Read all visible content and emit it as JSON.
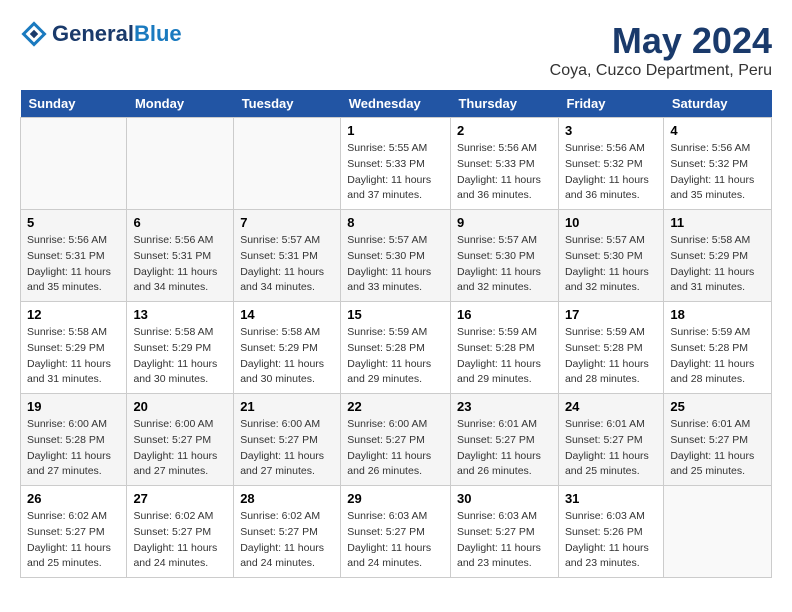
{
  "header": {
    "logo_line1": "General",
    "logo_line2": "Blue",
    "month_year": "May 2024",
    "location": "Coya, Cuzco Department, Peru"
  },
  "days_of_week": [
    "Sunday",
    "Monday",
    "Tuesday",
    "Wednesday",
    "Thursday",
    "Friday",
    "Saturday"
  ],
  "weeks": [
    [
      {
        "day": "",
        "sunrise": "",
        "sunset": "",
        "daylight": ""
      },
      {
        "day": "",
        "sunrise": "",
        "sunset": "",
        "daylight": ""
      },
      {
        "day": "",
        "sunrise": "",
        "sunset": "",
        "daylight": ""
      },
      {
        "day": "1",
        "sunrise": "5:55 AM",
        "sunset": "5:33 PM",
        "daylight": "11 hours and 37 minutes."
      },
      {
        "day": "2",
        "sunrise": "5:56 AM",
        "sunset": "5:33 PM",
        "daylight": "11 hours and 36 minutes."
      },
      {
        "day": "3",
        "sunrise": "5:56 AM",
        "sunset": "5:32 PM",
        "daylight": "11 hours and 36 minutes."
      },
      {
        "day": "4",
        "sunrise": "5:56 AM",
        "sunset": "5:32 PM",
        "daylight": "11 hours and 35 minutes."
      }
    ],
    [
      {
        "day": "5",
        "sunrise": "5:56 AM",
        "sunset": "5:31 PM",
        "daylight": "11 hours and 35 minutes."
      },
      {
        "day": "6",
        "sunrise": "5:56 AM",
        "sunset": "5:31 PM",
        "daylight": "11 hours and 34 minutes."
      },
      {
        "day": "7",
        "sunrise": "5:57 AM",
        "sunset": "5:31 PM",
        "daylight": "11 hours and 34 minutes."
      },
      {
        "day": "8",
        "sunrise": "5:57 AM",
        "sunset": "5:30 PM",
        "daylight": "11 hours and 33 minutes."
      },
      {
        "day": "9",
        "sunrise": "5:57 AM",
        "sunset": "5:30 PM",
        "daylight": "11 hours and 32 minutes."
      },
      {
        "day": "10",
        "sunrise": "5:57 AM",
        "sunset": "5:30 PM",
        "daylight": "11 hours and 32 minutes."
      },
      {
        "day": "11",
        "sunrise": "5:58 AM",
        "sunset": "5:29 PM",
        "daylight": "11 hours and 31 minutes."
      }
    ],
    [
      {
        "day": "12",
        "sunrise": "5:58 AM",
        "sunset": "5:29 PM",
        "daylight": "11 hours and 31 minutes."
      },
      {
        "day": "13",
        "sunrise": "5:58 AM",
        "sunset": "5:29 PM",
        "daylight": "11 hours and 30 minutes."
      },
      {
        "day": "14",
        "sunrise": "5:58 AM",
        "sunset": "5:29 PM",
        "daylight": "11 hours and 30 minutes."
      },
      {
        "day": "15",
        "sunrise": "5:59 AM",
        "sunset": "5:28 PM",
        "daylight": "11 hours and 29 minutes."
      },
      {
        "day": "16",
        "sunrise": "5:59 AM",
        "sunset": "5:28 PM",
        "daylight": "11 hours and 29 minutes."
      },
      {
        "day": "17",
        "sunrise": "5:59 AM",
        "sunset": "5:28 PM",
        "daylight": "11 hours and 28 minutes."
      },
      {
        "day": "18",
        "sunrise": "5:59 AM",
        "sunset": "5:28 PM",
        "daylight": "11 hours and 28 minutes."
      }
    ],
    [
      {
        "day": "19",
        "sunrise": "6:00 AM",
        "sunset": "5:28 PM",
        "daylight": "11 hours and 27 minutes."
      },
      {
        "day": "20",
        "sunrise": "6:00 AM",
        "sunset": "5:27 PM",
        "daylight": "11 hours and 27 minutes."
      },
      {
        "day": "21",
        "sunrise": "6:00 AM",
        "sunset": "5:27 PM",
        "daylight": "11 hours and 27 minutes."
      },
      {
        "day": "22",
        "sunrise": "6:00 AM",
        "sunset": "5:27 PM",
        "daylight": "11 hours and 26 minutes."
      },
      {
        "day": "23",
        "sunrise": "6:01 AM",
        "sunset": "5:27 PM",
        "daylight": "11 hours and 26 minutes."
      },
      {
        "day": "24",
        "sunrise": "6:01 AM",
        "sunset": "5:27 PM",
        "daylight": "11 hours and 25 minutes."
      },
      {
        "day": "25",
        "sunrise": "6:01 AM",
        "sunset": "5:27 PM",
        "daylight": "11 hours and 25 minutes."
      }
    ],
    [
      {
        "day": "26",
        "sunrise": "6:02 AM",
        "sunset": "5:27 PM",
        "daylight": "11 hours and 25 minutes."
      },
      {
        "day": "27",
        "sunrise": "6:02 AM",
        "sunset": "5:27 PM",
        "daylight": "11 hours and 24 minutes."
      },
      {
        "day": "28",
        "sunrise": "6:02 AM",
        "sunset": "5:27 PM",
        "daylight": "11 hours and 24 minutes."
      },
      {
        "day": "29",
        "sunrise": "6:03 AM",
        "sunset": "5:27 PM",
        "daylight": "11 hours and 24 minutes."
      },
      {
        "day": "30",
        "sunrise": "6:03 AM",
        "sunset": "5:27 PM",
        "daylight": "11 hours and 23 minutes."
      },
      {
        "day": "31",
        "sunrise": "6:03 AM",
        "sunset": "5:26 PM",
        "daylight": "11 hours and 23 minutes."
      },
      {
        "day": "",
        "sunrise": "",
        "sunset": "",
        "daylight": ""
      }
    ]
  ],
  "labels": {
    "sunrise_prefix": "Sunrise: ",
    "sunset_prefix": "Sunset: ",
    "daylight_prefix": "Daylight: "
  }
}
